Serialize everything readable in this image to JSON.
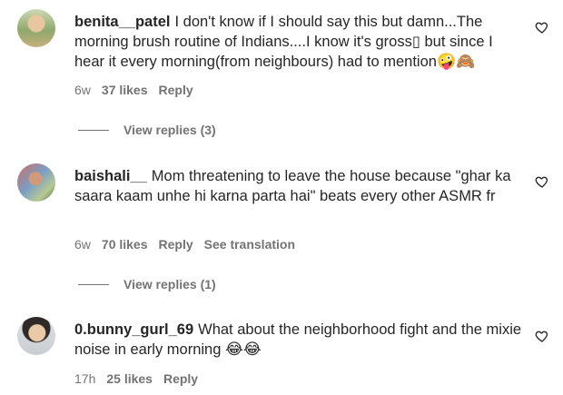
{
  "comments": [
    {
      "username": "benita__patel",
      "text": "I don't know if I should say this but damn...The morning brush routine of Indians....I know it's gross▯ but since I hear it every morning(from neighbours) had to mention",
      "emojis": "🤪🙈",
      "time": "6w",
      "likes": "37 likes",
      "reply": "Reply",
      "translation": "",
      "view_replies": "View replies (3)"
    },
    {
      "username": "baishali__",
      "text": "Mom threatening to leave the house because \"ghar ka saara kaam unhe hi karna parta hai\" beats every other ASMR fr",
      "emojis": "",
      "time": "6w",
      "likes": "70 likes",
      "reply": "Reply",
      "translation": "See translation",
      "view_replies": "View replies (1)"
    },
    {
      "username": "0.bunny_gurl_69",
      "text": "What about the neighborhood fight and the mixie noise in early morning",
      "emojis": "😂😂",
      "time": "17h",
      "likes": "25 likes",
      "reply": "Reply",
      "translation": "",
      "view_replies": ""
    }
  ],
  "icons": {
    "avatar": "profile-picture",
    "like": "heart-outline-icon"
  },
  "colors": {
    "text": "#262626",
    "secondary": "#737373",
    "background": "#ffffff"
  }
}
